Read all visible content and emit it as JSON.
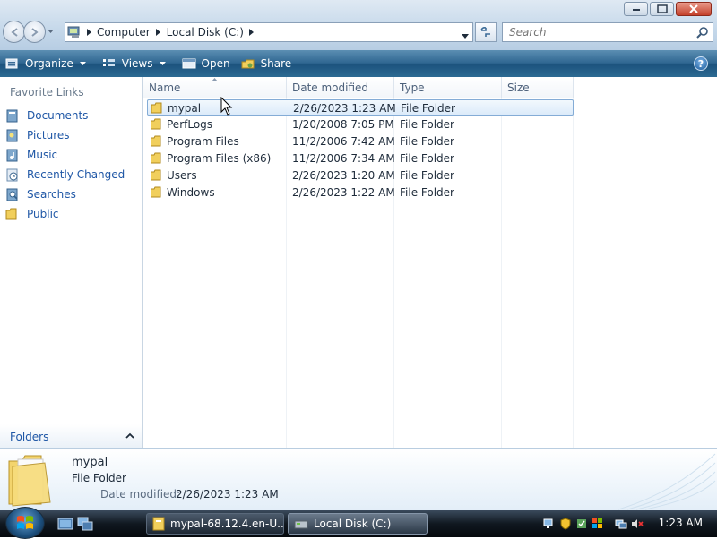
{
  "address_bar": {
    "crumbs": [
      "Computer",
      "Local Disk (C:)"
    ],
    "search_placeholder": "Search"
  },
  "toolbar": {
    "organize": "Organize",
    "views": "Views",
    "open": "Open",
    "share": "Share",
    "help": "?"
  },
  "nav_pane": {
    "header": "Favorite Links",
    "items": [
      {
        "label": "Documents",
        "icon": "documents-icon"
      },
      {
        "label": "Pictures",
        "icon": "pictures-icon"
      },
      {
        "label": "Music",
        "icon": "music-icon"
      },
      {
        "label": "Recently Changed",
        "icon": "recently-changed-icon"
      },
      {
        "label": "Searches",
        "icon": "searches-icon"
      },
      {
        "label": "Public",
        "icon": "public-folder-icon"
      }
    ],
    "folders_label": "Folders"
  },
  "file_list": {
    "columns": [
      "Name",
      "Date modified",
      "Type",
      "Size"
    ],
    "rows": [
      {
        "name": "mypal",
        "date": "2/26/2023 1:23 AM",
        "type": "File Folder"
      },
      {
        "name": "PerfLogs",
        "date": "1/20/2008 7:05 PM",
        "type": "File Folder"
      },
      {
        "name": "Program Files",
        "date": "11/2/2006 7:42 AM",
        "type": "File Folder"
      },
      {
        "name": "Program Files (x86)",
        "date": "11/2/2006 7:34 AM",
        "type": "File Folder"
      },
      {
        "name": "Users",
        "date": "2/26/2023 1:20 AM",
        "type": "File Folder"
      },
      {
        "name": "Windows",
        "date": "2/26/2023 1:22 AM",
        "type": "File Folder"
      }
    ]
  },
  "details": {
    "name": "mypal",
    "type": "File Folder",
    "date_label": "Date modified:",
    "date_value": "2/26/2023 1:23 AM"
  },
  "taskbar": {
    "tasks": [
      "mypal-68.12.4.en-U...",
      "Local Disk (C:)"
    ],
    "clock": "1:23 AM"
  },
  "colors": {
    "link": "#1f57a6",
    "command_bar": "#2f6691",
    "selection_border": "#84acd6"
  }
}
